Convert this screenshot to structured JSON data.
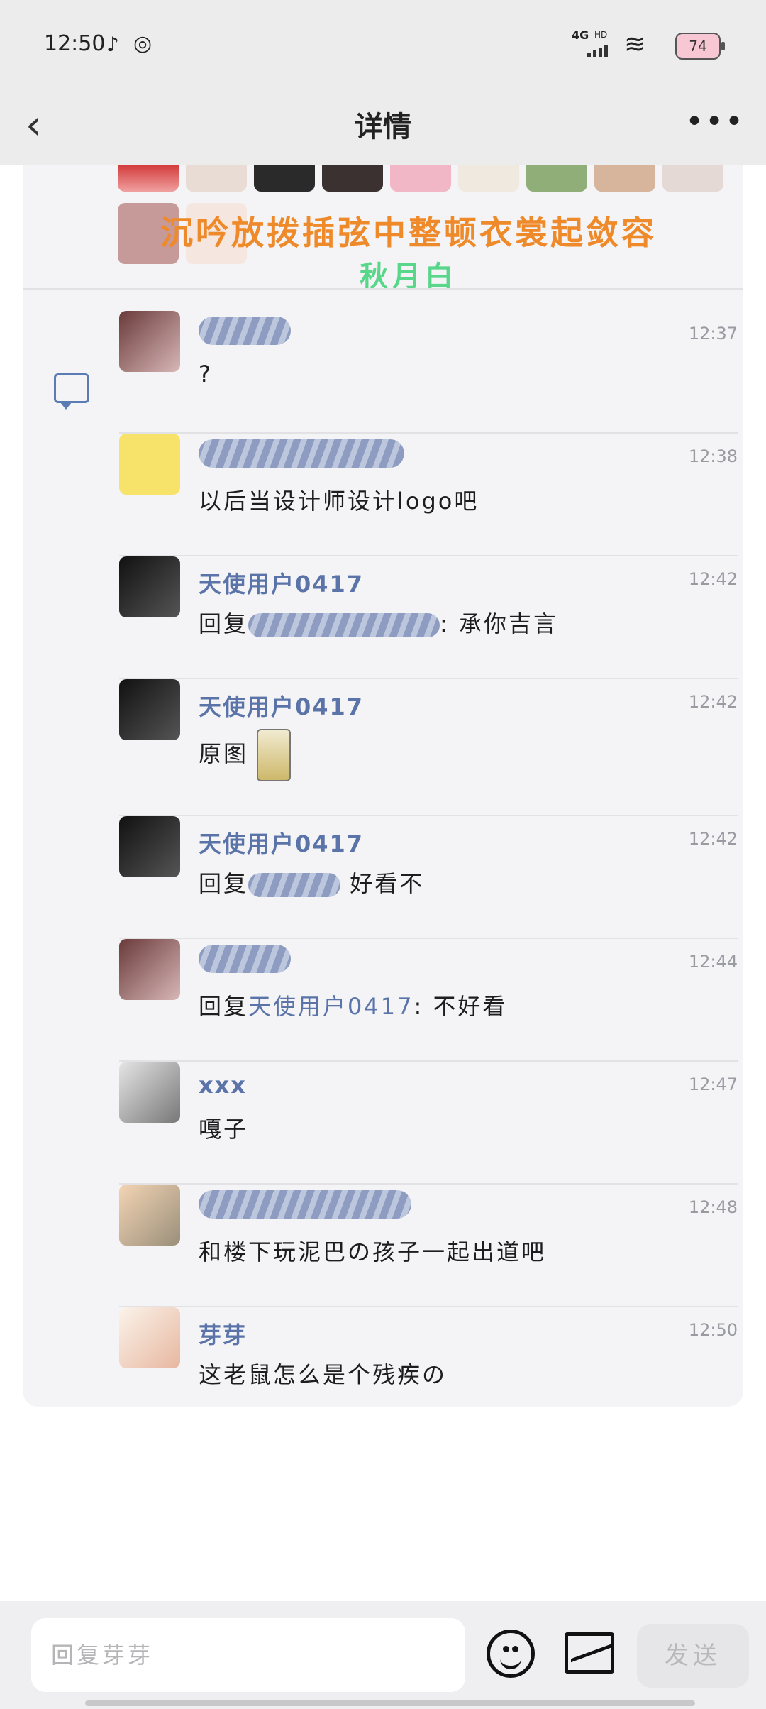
{
  "status": {
    "time": "12:50",
    "network": "4G",
    "hd": "HD",
    "battery": "74"
  },
  "nav": {
    "title": "详情",
    "back_icon": "‹",
    "more_icon": "•••"
  },
  "overlay": {
    "line1": "沉吟放拨插弦中整顿衣裳起敛容",
    "line2": "秋月白"
  },
  "replies": [
    {
      "name": "",
      "time": "12:37",
      "text": "?"
    },
    {
      "name": "",
      "time": "12:38",
      "text": "以后当设计师设计logo吧"
    },
    {
      "name": "天使用户0417",
      "time": "12:42",
      "prefix": "回复",
      "suffix": ": 承你吉言"
    },
    {
      "name": "天使用户0417",
      "time": "12:42",
      "text": "原图"
    },
    {
      "name": "天使用户0417",
      "time": "12:42",
      "prefix": "回复",
      "suffix": " 好看不"
    },
    {
      "name": "",
      "time": "12:44",
      "prefix": "回复",
      "mention": "天使用户0417",
      "suffix": ": 不好看"
    },
    {
      "name": "xxx",
      "time": "12:47",
      "text": "嘎子"
    },
    {
      "name": "",
      "time": "12:48",
      "text": "和楼下玩泥巴の孩子一起出道吧"
    },
    {
      "name": "芽芽",
      "time": "12:50",
      "text": "这老鼠怎么是个残疾の"
    }
  ],
  "composer": {
    "placeholder": "回复芽芽",
    "send_label": "发送"
  },
  "colors": {
    "accent": "#5a73a8",
    "overlay1": "#ef8a2a",
    "overlay2": "#58d68a"
  }
}
